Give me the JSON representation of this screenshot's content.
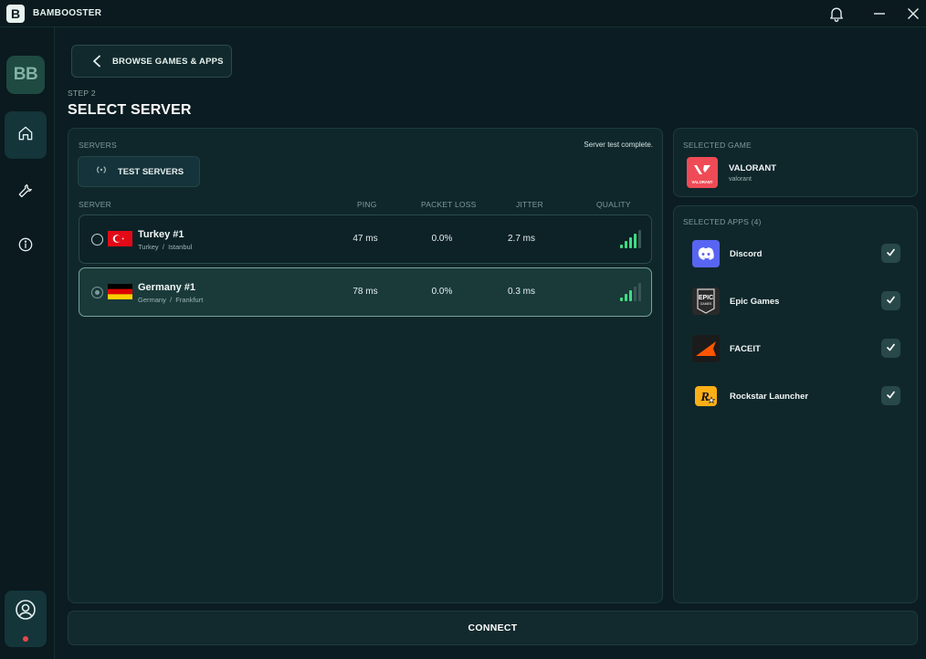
{
  "titlebar": {
    "logo_letter": "B",
    "app_title": "BAMBOOSTER",
    "icons": [
      "bell-icon",
      "minimize-icon",
      "close-icon"
    ]
  },
  "sidebar": {
    "logo_text": "BB",
    "nav": [
      {
        "id": "home",
        "icon": "home-icon",
        "active": true
      },
      {
        "id": "tools",
        "icon": "wrench-icon",
        "active": false
      },
      {
        "id": "info",
        "icon": "info-icon",
        "active": false
      }
    ],
    "profile_icon": "user-icon",
    "status_color": "#e5484d"
  },
  "header": {
    "back_label": "BROWSE GAMES & APPS",
    "step_label": "STEP 2",
    "title": "SELECT SERVER"
  },
  "servers": {
    "section_label": "SERVERS",
    "status": "Server test complete.",
    "test_button_label": "TEST SERVERS",
    "columns": {
      "server": "SERVER",
      "ping": "PING",
      "packet_loss": "PACKET LOSS",
      "jitter": "JITTER",
      "quality": "QUALITY"
    },
    "rows": [
      {
        "name": "Turkey #1",
        "country": "Turkey",
        "separator": "/",
        "city": "Istanbul",
        "ping": "47 ms",
        "packet_loss": "0.0%",
        "jitter": "2.7 ms",
        "quality_bars": 4,
        "selected": false,
        "flag": "turkey"
      },
      {
        "name": "Germany #1",
        "country": "Germany",
        "separator": "/",
        "city": "Frankfurt",
        "ping": "78 ms",
        "packet_loss": "0.0%",
        "jitter": "0.3 ms",
        "quality_bars": 3,
        "selected": true,
        "flag": "germany"
      }
    ]
  },
  "selected_game": {
    "section_label": "SELECTED GAME",
    "name": "VALORANT",
    "subtitle": "valorant",
    "icon_text": "VALORANT",
    "icon_color": "#ef4b56"
  },
  "selected_apps": {
    "section_label": "SELECTED APPS (4)",
    "apps": [
      {
        "name": "Discord",
        "icon": "discord-icon",
        "checked": true
      },
      {
        "name": "Epic Games",
        "icon": "epic-games-icon",
        "icon_text_1": "EPIC",
        "icon_text_2": "GAMES",
        "checked": true
      },
      {
        "name": "FACEIT",
        "icon": "faceit-icon",
        "checked": true
      },
      {
        "name": "Rockstar Launcher",
        "icon": "rockstar-icon",
        "icon_text": "R",
        "checked": true
      }
    ]
  },
  "connect_label": "CONNECT",
  "colors": {
    "background": "#0b1d22",
    "panel": "#0f272b",
    "accent_green": "#3ddc84",
    "selected_border": "#7aa39a"
  }
}
